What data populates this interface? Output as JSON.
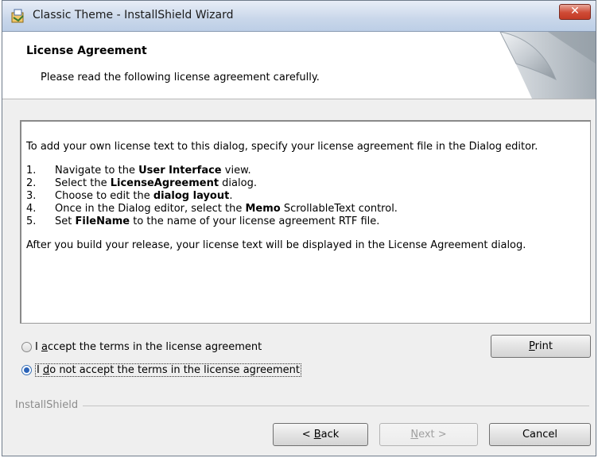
{
  "window": {
    "title": "Classic Theme - InstallShield Wizard",
    "close_label": "✕"
  },
  "header": {
    "title": "License Agreement",
    "subtitle": "Please read the following license agreement carefully."
  },
  "license": {
    "intro": "To add your own license text to this dialog, specify your license agreement file in the Dialog editor.",
    "steps": [
      {
        "num": "1.",
        "before": "Navigate to the ",
        "bold": "User Interface",
        "after": " view."
      },
      {
        "num": "2.",
        "before": "Select the ",
        "bold": "LicenseAgreement",
        "after": " dialog."
      },
      {
        "num": "3.",
        "before": "Choose to edit the ",
        "bold": "dialog layout",
        "after": "."
      },
      {
        "num": "4.",
        "before": "Once in the Dialog editor, select the ",
        "bold": "Memo",
        "after": " ScrollableText control."
      },
      {
        "num": "5.",
        "before": "Set ",
        "bold": "FileName",
        "after": " to the name of your license agreement RTF file."
      }
    ],
    "outro": "After you build your release, your license text will be displayed in the License Agreement dialog."
  },
  "options": {
    "accept": {
      "label": "I accept the terms in the license agreement",
      "mnemonic": "a",
      "checked": false
    },
    "decline": {
      "label": "I do not accept the terms in the license agreement",
      "mnemonic": "d",
      "checked": true
    }
  },
  "brand": "InstallShield",
  "buttons": {
    "print": "Print",
    "back": "< Back",
    "next": "Next >",
    "cancel": "Cancel"
  }
}
